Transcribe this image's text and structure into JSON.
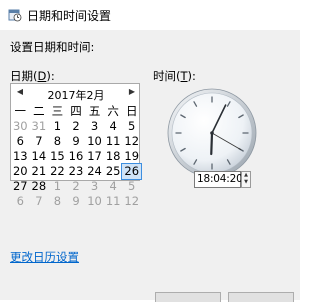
{
  "window": {
    "title": "日期和时间设置",
    "icon": "calendar-clock-icon"
  },
  "heading": "设置日期和时间:",
  "date": {
    "label_prefix": "日期(",
    "label_key": "D",
    "label_suffix": "):"
  },
  "calendar": {
    "month_title": "2017年2月",
    "prev_icon": "◀",
    "next_icon": "▶",
    "weekdays": [
      "一",
      "二",
      "三",
      "四",
      "五",
      "六",
      "日"
    ],
    "selected_day": "26",
    "weeks": [
      [
        {
          "d": "30",
          "o": true
        },
        {
          "d": "31",
          "o": true
        },
        {
          "d": "1"
        },
        {
          "d": "2"
        },
        {
          "d": "3"
        },
        {
          "d": "4"
        },
        {
          "d": "5"
        }
      ],
      [
        {
          "d": "6"
        },
        {
          "d": "7"
        },
        {
          "d": "8"
        },
        {
          "d": "9"
        },
        {
          "d": "10"
        },
        {
          "d": "11"
        },
        {
          "d": "12"
        }
      ],
      [
        {
          "d": "13"
        },
        {
          "d": "14"
        },
        {
          "d": "15"
        },
        {
          "d": "16"
        },
        {
          "d": "17"
        },
        {
          "d": "18"
        },
        {
          "d": "19"
        }
      ],
      [
        {
          "d": "20"
        },
        {
          "d": "21"
        },
        {
          "d": "22"
        },
        {
          "d": "23"
        },
        {
          "d": "24"
        },
        {
          "d": "25"
        },
        {
          "d": "26"
        }
      ],
      [
        {
          "d": "27"
        },
        {
          "d": "28"
        },
        {
          "d": "1",
          "o": true
        },
        {
          "d": "2",
          "o": true
        },
        {
          "d": "3",
          "o": true
        },
        {
          "d": "4",
          "o": true
        },
        {
          "d": "5",
          "o": true
        }
      ],
      [
        {
          "d": "6",
          "o": true
        },
        {
          "d": "7",
          "o": true
        },
        {
          "d": "8",
          "o": true
        },
        {
          "d": "9",
          "o": true
        },
        {
          "d": "10",
          "o": true
        },
        {
          "d": "11",
          "o": true
        },
        {
          "d": "12",
          "o": true
        }
      ]
    ]
  },
  "time": {
    "label_prefix": "时间(",
    "label_key": "T",
    "label_suffix": "):",
    "value": "18:04:20",
    "hour": 18,
    "minute": 4,
    "second": 20
  },
  "link_text": "更改日历设置",
  "colors": {
    "link": "#0066cc",
    "selection": "#3c8ee0",
    "panel": "#f0f0f0"
  }
}
